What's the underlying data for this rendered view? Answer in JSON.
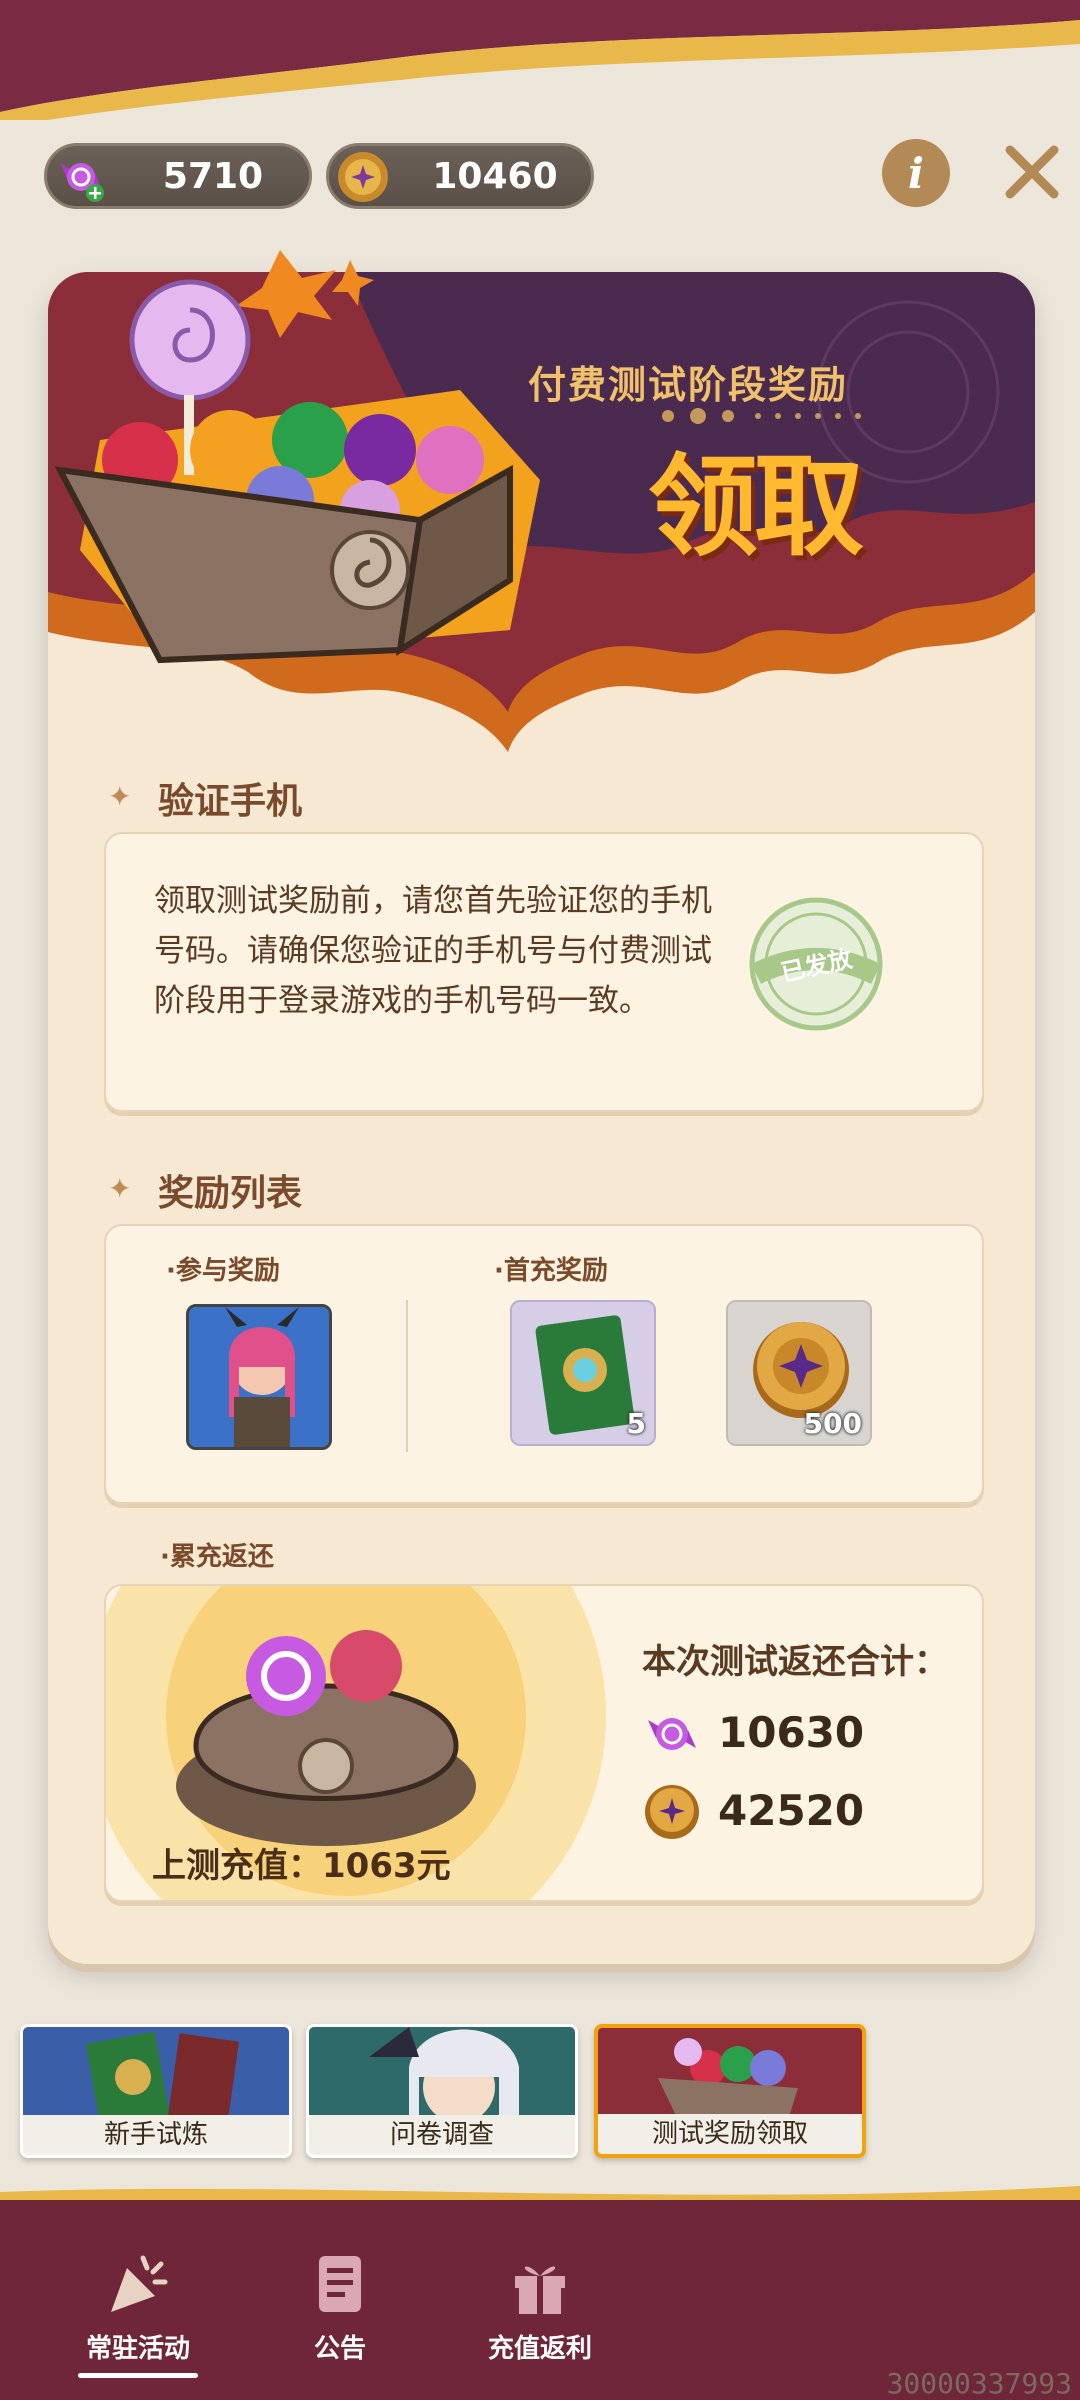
{
  "currency": {
    "candy": {
      "value": "5710",
      "icon": "candy-plus-icon"
    },
    "coin": {
      "value": "10460",
      "icon": "gold-coin-icon"
    }
  },
  "controls": {
    "info_label": "i",
    "close_icon": "close-icon"
  },
  "banner": {
    "subtitle": "付费测试阶段奖励",
    "claim_label": "领取"
  },
  "verify": {
    "title": "验证手机",
    "text": "领取测试奖励前，请您首先验证您的手机号码。请确保您验证的手机号与付费测试阶段用于登录游戏的手机号码一致。",
    "stamp": "已发放"
  },
  "rewards": {
    "title": "奖励列表",
    "participate_label": "·参与奖励",
    "first_charge_label": "·首充奖励",
    "items": [
      {
        "name": "character-portrait",
        "count": ""
      },
      {
        "name": "card-pack",
        "count": "5"
      },
      {
        "name": "gold-coin",
        "count": "500"
      }
    ]
  },
  "refund": {
    "label": "·累充返还",
    "total_label": "本次测试返还合计：",
    "candy_amount": "10630",
    "coin_amount": "42520",
    "recharge_text": "上测充值：1063元"
  },
  "tabs": [
    {
      "label": "新手试炼"
    },
    {
      "label": "问卷调查"
    },
    {
      "label": "测试奖励领取",
      "selected": true
    }
  ],
  "nav": [
    {
      "label": "常驻活动",
      "active": true,
      "icon": "party-popper-icon"
    },
    {
      "label": "公告",
      "icon": "document-icon"
    },
    {
      "label": "充值返利",
      "icon": "gift-icon"
    }
  ],
  "build_id": "30000337993",
  "colors": {
    "accent": "#f2a20a",
    "nav_bg": "#6e2638",
    "card_bg": "#f7e8d4"
  }
}
